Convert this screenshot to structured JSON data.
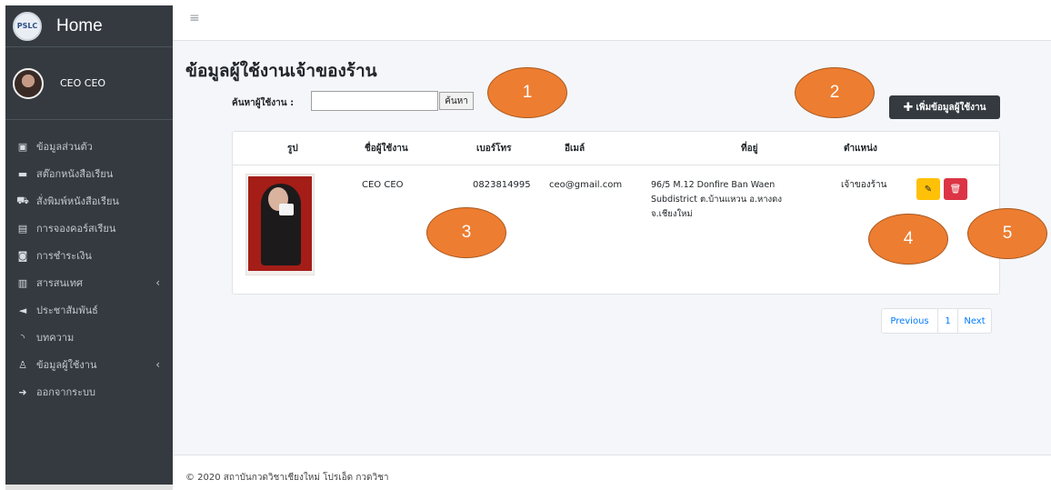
{
  "sidebar": {
    "brand": "Home",
    "logo_text": "PSLC",
    "user_name": "CEO CEO",
    "items": [
      {
        "label": "ข้อมูลส่วนตัว",
        "icon": "id-card-icon"
      },
      {
        "label": "สต๊อกหนังสือเรียน",
        "icon": "archive-icon"
      },
      {
        "label": "สั่งพิมพ์หนังสือเรียน",
        "icon": "cart-icon"
      },
      {
        "label": "การจองคอร์สเรียน",
        "icon": "file-icon"
      },
      {
        "label": "การชำระเงิน",
        "icon": "money-icon"
      },
      {
        "label": "สารสนเทศ",
        "icon": "chart-icon",
        "chevron": "‹"
      },
      {
        "label": "ประชาสัมพันธ์",
        "icon": "megaphone-icon"
      },
      {
        "label": "บทความ",
        "icon": "rss-icon"
      },
      {
        "label": "ข้อมูลผู้ใช้งาน",
        "icon": "user-icon",
        "chevron": "‹"
      },
      {
        "label": "ออกจากระบบ",
        "icon": "sign-out-icon"
      }
    ]
  },
  "topbar": {
    "menu_icon": "≡"
  },
  "main": {
    "title": "ข้อมูลผู้ใช้งานเจ้าของร้าน",
    "search_label": "ค้นหาผู้ใช้งาน :",
    "search_value": "",
    "search_button": "ค้นหา",
    "add_button": "เพิ่มข้อมูลผู้ใช้งาน",
    "columns": [
      "รูป",
      "ชื่อผู้ใช้งาน",
      "เบอร์โทร",
      "อีเมล์",
      "ที่อยู่",
      "ตำแหน่ง"
    ],
    "rows": [
      {
        "name": "CEO CEO",
        "phone": "0823814995",
        "email": "ceo@gmail.com",
        "address_line1": "96/5 M.12 Donfire Ban Waen",
        "address_line2": "Subdistrict ต.บ้านแหวน อ.หางดง",
        "address_line3": "จ.เชียงใหม่",
        "position": "เจ้าของร้าน"
      }
    ],
    "pagination": {
      "previous": "Previous",
      "page": "1",
      "next": "Next"
    }
  },
  "footer": {
    "text": "© 2020 สถาบันกวดวิชาเชียงใหม่ โปรเอ็ด กวดวิชา"
  },
  "callouts": [
    "1",
    "2",
    "3",
    "4",
    "5"
  ],
  "colors": {
    "sidebar": "#343a40",
    "callout": "#ed7d31",
    "edit": "#ffc107",
    "delete": "#dc3545",
    "link": "#007bff"
  }
}
